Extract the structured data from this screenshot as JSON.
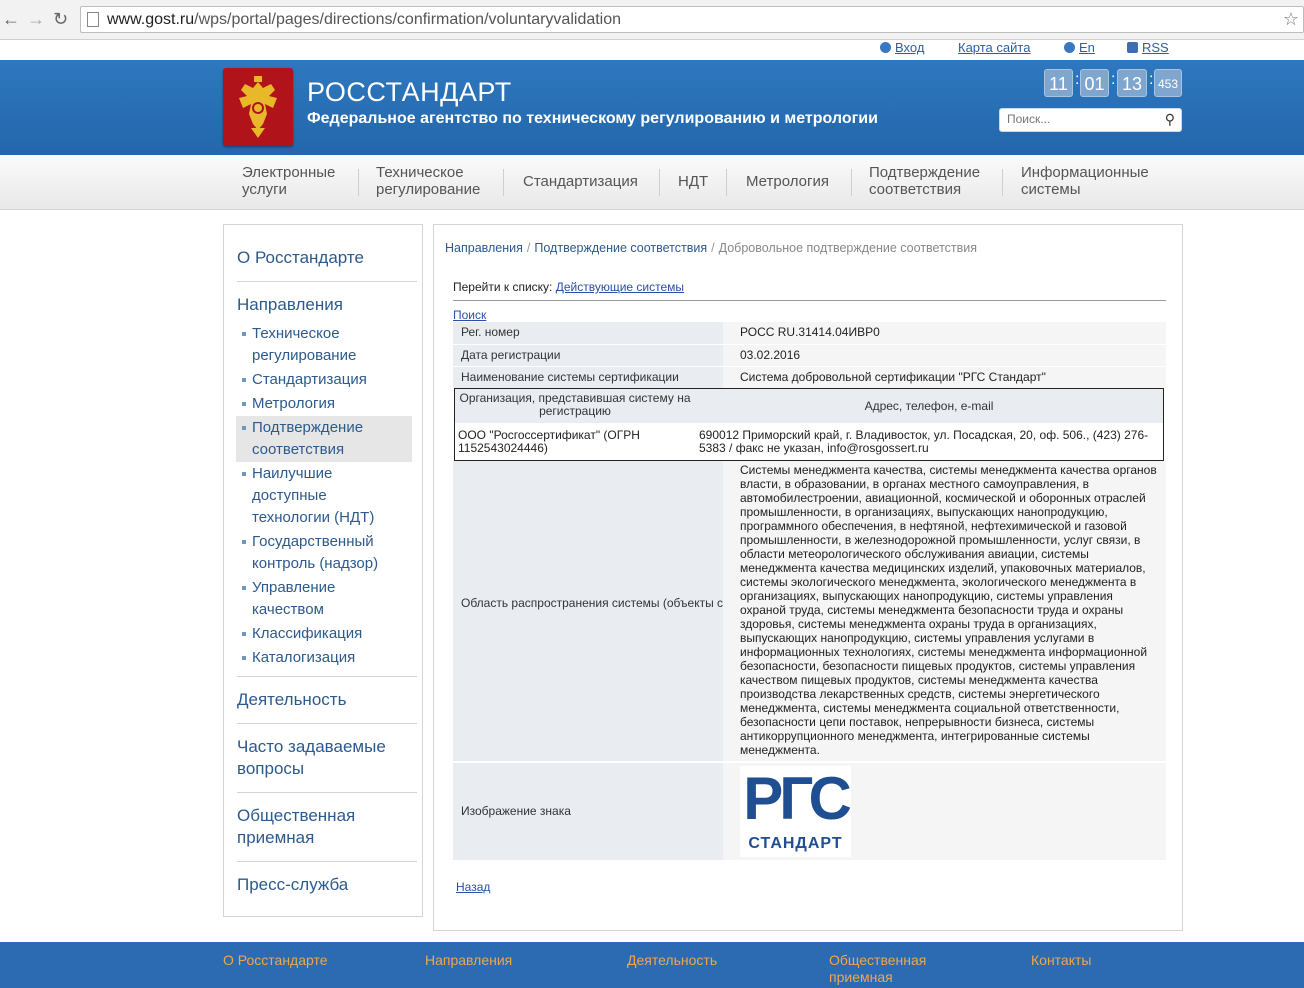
{
  "browser": {
    "back_icon": "arrow-left",
    "forward_icon": "arrow-right",
    "reload_icon": "reload",
    "url_domain": "www.gost.ru",
    "url_path": "/wps/portal/pages/directions/confirmation/voluntaryvalidation"
  },
  "toplinks": {
    "login": "Вход",
    "sitemap": "Карта сайта",
    "en": "En",
    "rss": "RSS"
  },
  "header": {
    "title": "РОССТАНДАРТ",
    "subtitle": "Федеральное агентство по техническому регулированию и метрологии",
    "clock": {
      "h": "11",
      "m": "01",
      "s": "13",
      "ms": "453"
    },
    "search_placeholder": "Поиск..."
  },
  "menu": {
    "items": [
      {
        "l1": "Электронные",
        "l2": "услуги"
      },
      {
        "l1": "Техническое",
        "l2": "регулирование"
      },
      {
        "l1": "Стандартизация",
        "l2": ""
      },
      {
        "l1": "НДТ",
        "l2": ""
      },
      {
        "l1": "Метрология",
        "l2": ""
      },
      {
        "l1": "Подтверждение",
        "l2": "соответствия"
      },
      {
        "l1": "Информационные",
        "l2": "системы"
      }
    ]
  },
  "sidebar": {
    "about": "О Росстандарте",
    "directions": "Направления",
    "sub": [
      {
        "l1": "Техническое",
        "l2": "регулирование"
      },
      {
        "l1": "Стандартизация",
        "l2": ""
      },
      {
        "l1": "Метрология",
        "l2": ""
      },
      {
        "l1": "Подтверждение",
        "l2": "соответствия"
      },
      {
        "l1": "Наилучшие",
        "l2": "доступные",
        "l3": "технологии (НДТ)"
      },
      {
        "l1": "Государственный",
        "l2": "контроль (надзор)"
      },
      {
        "l1": "Управление",
        "l2": "качеством"
      },
      {
        "l1": "Классификация",
        "l2": ""
      },
      {
        "l1": "Каталогизация",
        "l2": ""
      }
    ],
    "activity": "Деятельность",
    "faq_1": "Часто задаваемые",
    "faq_2": "вопросы",
    "reception_1": "Общественная",
    "reception_2": "приемная",
    "press": "Пресс-служба"
  },
  "content": {
    "breadcrumb": [
      "Направления",
      "Подтверждение соответствия",
      "Добровольное подтверждение соответствия"
    ],
    "goto_label": "Перейти к списку:",
    "goto_link": "Действующие системы",
    "search_link": "Поиск",
    "reg_number_label": "Рег. номер",
    "reg_number": "РОСС RU.31414.04ИВР0",
    "reg_date_label": "Дата регистрации",
    "reg_date": "03.02.2016",
    "system_name_label": "Наименование системы сертификации",
    "system_name": "Система добровольной сертификации \"РГС Стандарт\"",
    "org_header": "Организация, представившая систему на регистрацию",
    "contacts_header": "Адрес, телефон, e-mail",
    "org_name": "ООО \"Росгоссертификат\" (ОГРН 1152543024446)",
    "org_contacts": "690012 Приморский край, г. Владивосток, ул. Посадская, 20, оф. 506., (423) 276-5383 / факс не указан, info@rosgossert.ru",
    "scope_label": "Область распространения системы (объекты сертификации)",
    "scope": "Системы менеджмента качества, системы менеджмента качества органов власти, в образовании, в органах местного самоуправления, в автомобилестроении, авиационной, космической и оборонных отраслей промышленности, в организациях, выпускающих нанопродукцию, программного обеспечения, в нефтяной, нефтехимической и газовой промышленности, в железнодорожной промышленности, услуг связи, в области метеорологического обслуживания авиации, системы менеджмента качества медицинских изделий, упаковочных материалов, системы экологического менеджмента, экологического менеджмента в организациях, выпускающих нанопродукцию, системы управления охраной труда, системы менеджмента безопасности труда и охраны здоровья, системы менеджмента охраны труда в организациях, выпускающих нанопродукцию, системы управления услугами в информационных технологиях, системы менеджмента информационной безопасности, безопасности пищевых продуктов, системы управления качеством пищевых продуктов, системы менеджмента качества производства лекарственных средств, системы энергетического менеджмента, системы менеджмента социальной ответственности, безопасности цепи поставок, непрерывности бизнеса, системы антикоррупционного менеджмента, интегрированные системы менеджмента.",
    "image_label": "Изображение знака",
    "logo_letters": "РГС",
    "logo_word": "СТАНДАРТ",
    "back_link": "Назад"
  },
  "footer": {
    "about": "О Росстандарте",
    "directions": "Направления",
    "activity": "Деятельность",
    "reception_1": "Общественная",
    "reception_2": "приемная",
    "contacts": "Контакты"
  },
  "colors": {
    "header_blue": "#2a70b7",
    "link_blue": "#2d5a8d",
    "footer_orange": "#f0a64a",
    "emblem_red": "#b0131a"
  }
}
